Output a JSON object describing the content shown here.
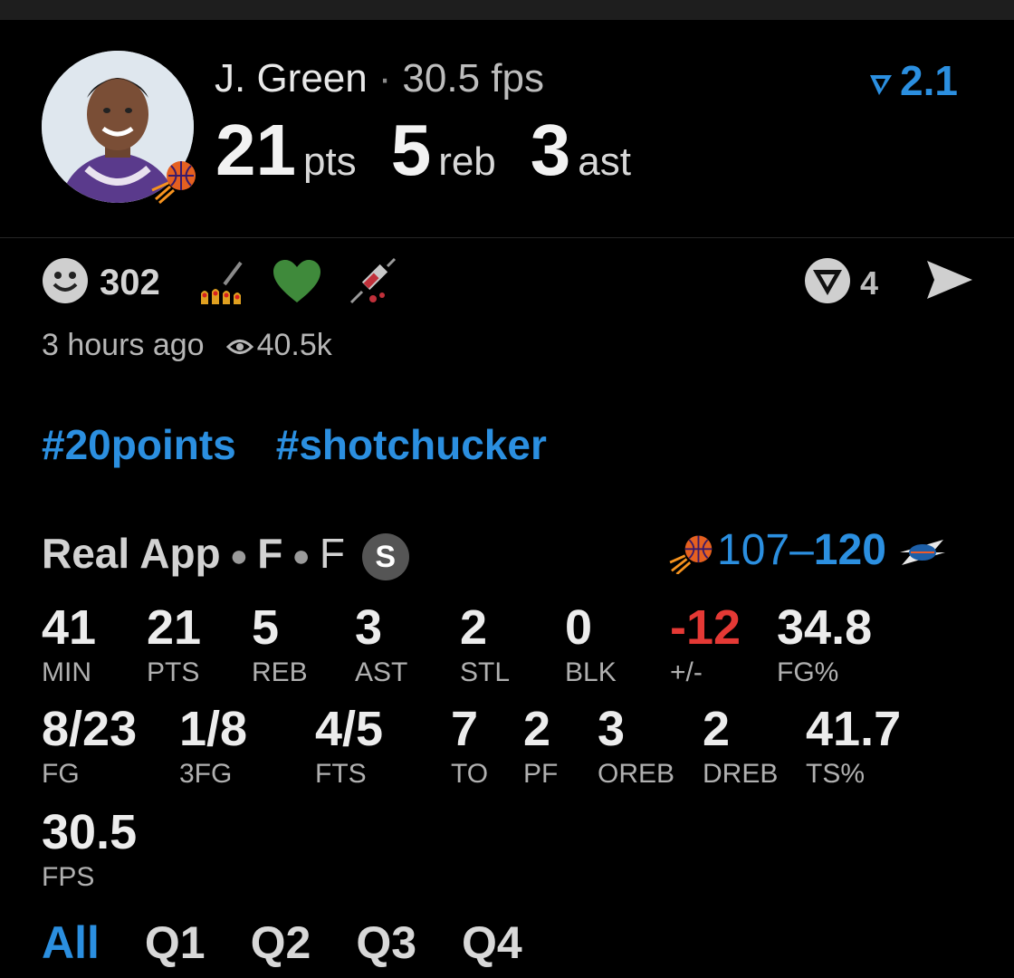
{
  "player": {
    "name": "J. Green",
    "fps_text": "30.5 fps",
    "headline": [
      {
        "value": "21",
        "unit": "pts"
      },
      {
        "value": "5",
        "unit": "reb"
      },
      {
        "value": "3",
        "unit": "ast"
      }
    ],
    "rating": "2.1"
  },
  "reactions": {
    "smile_count": "302",
    "comment_count": "4",
    "icons": [
      "smile-icon",
      "nail-polish-icon",
      "green-heart-icon",
      "syringe-icon",
      "comment-icon",
      "send-icon"
    ]
  },
  "meta": {
    "time_ago": "3 hours ago",
    "views": "40.5k"
  },
  "tags": [
    "#20points",
    "#shotchucker"
  ],
  "game": {
    "source": "Real App",
    "status1": "F",
    "status2": "F",
    "badge": "S",
    "score_home": "107",
    "score_dash": "–",
    "score_away": "120"
  },
  "stats_row1": [
    {
      "value": "41",
      "label": "MIN"
    },
    {
      "value": "21",
      "label": "PTS"
    },
    {
      "value": "5",
      "label": "REB"
    },
    {
      "value": "3",
      "label": "AST"
    },
    {
      "value": "2",
      "label": "STL"
    },
    {
      "value": "0",
      "label": "BLK"
    },
    {
      "value": "-12",
      "label": "+/-"
    },
    {
      "value": "34.8",
      "label": "FG%"
    }
  ],
  "stats_row2": [
    {
      "value": "8/23",
      "label": "FG"
    },
    {
      "value": "1/8",
      "label": "3FG"
    },
    {
      "value": "4/5",
      "label": "FTS"
    },
    {
      "value": "7",
      "label": "TO"
    },
    {
      "value": "2",
      "label": "PF"
    },
    {
      "value": "3",
      "label": "OREB"
    },
    {
      "value": "2",
      "label": "DREB"
    },
    {
      "value": "41.7",
      "label": "TS%"
    }
  ],
  "stats_row3": [
    {
      "value": "30.5",
      "label": "FPS"
    }
  ],
  "quarters": [
    "All",
    "Q1",
    "Q2",
    "Q3",
    "Q4"
  ],
  "colors": {
    "accent": "#2b8fe0",
    "negative": "#e53935",
    "background": "#000000"
  }
}
